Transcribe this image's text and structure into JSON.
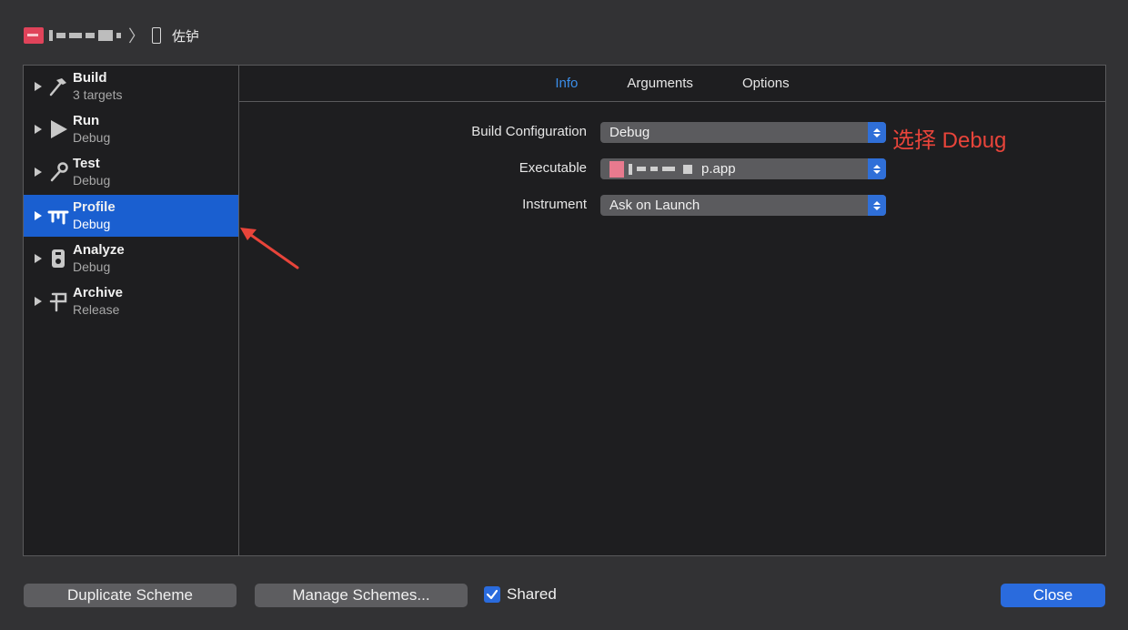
{
  "titlebar": {
    "device_name": "佐𬬻"
  },
  "sidebar": {
    "items": [
      {
        "title": "Build",
        "subtitle": "3 targets",
        "icon": "hammer-icon"
      },
      {
        "title": "Run",
        "subtitle": "Debug",
        "icon": "play-icon"
      },
      {
        "title": "Test",
        "subtitle": "Debug",
        "icon": "wrench-icon"
      },
      {
        "title": "Profile",
        "subtitle": "Debug",
        "icon": "instruments-icon",
        "selected": true
      },
      {
        "title": "Analyze",
        "subtitle": "Debug",
        "icon": "analyze-icon"
      },
      {
        "title": "Archive",
        "subtitle": "Release",
        "icon": "archive-icon"
      }
    ]
  },
  "tabs": [
    {
      "label": "Info",
      "active": true
    },
    {
      "label": "Arguments"
    },
    {
      "label": "Options"
    }
  ],
  "form": {
    "build_configuration_label": "Build Configuration",
    "build_configuration_value": "Debug",
    "executable_label": "Executable",
    "executable_value": "p.app",
    "instrument_label": "Instrument",
    "instrument_value": "Ask on Launch"
  },
  "annotation": {
    "text": "选择 Debug",
    "color": "#e8443a"
  },
  "footer": {
    "duplicate_label": "Duplicate Scheme",
    "manage_label": "Manage Schemes...",
    "shared_label": "Shared",
    "shared_checked": true,
    "close_label": "Close"
  },
  "colors": {
    "accent": "#2a6bdd",
    "selection": "#1a5fd0",
    "active_tab": "#3b8eea"
  }
}
